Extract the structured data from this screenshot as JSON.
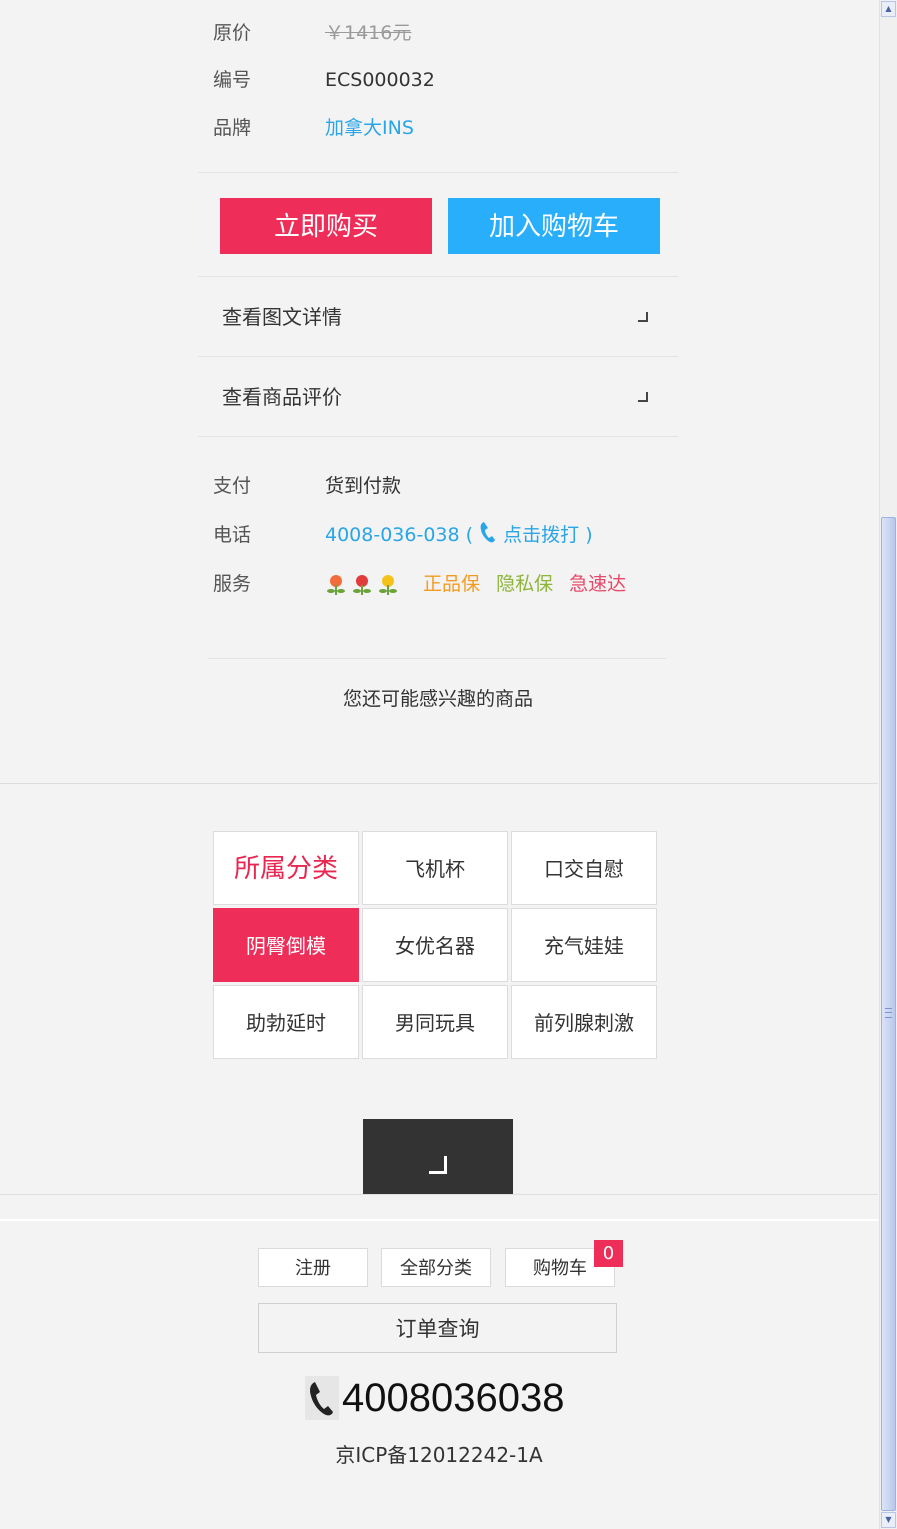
{
  "product_info": {
    "original_price_label": "原价",
    "original_price_value": "￥1416元",
    "sku_label": "编号",
    "sku_value": "ECS000032",
    "brand_label": "品牌",
    "brand_value": "加拿大INS"
  },
  "actions": {
    "buy_now": "立即购买",
    "add_to_cart": "加入购物车"
  },
  "detail_links": {
    "view_details": "查看图文详情",
    "view_reviews": "查看商品评价"
  },
  "service_info": {
    "payment_label": "支付",
    "payment_value": "货到付款",
    "phone_label": "电话",
    "phone_number": "4008-036-038",
    "phone_open_paren": "(",
    "phone_call_text": "点击拨打",
    "phone_close_paren": ")",
    "service_label": "服务",
    "service_tags": [
      "正品保",
      "隐私保",
      "急速达"
    ]
  },
  "recommend_title": "您还可能感兴趣的商品",
  "categories": {
    "title": "所属分类",
    "items": [
      "飞机杯",
      "口交自慰",
      "阴臀倒模",
      "女优名器",
      "充气娃娃",
      "助勃延时",
      "男同玩具",
      "前列腺刺激"
    ]
  },
  "footer": {
    "register": "注册",
    "all_categories": "全部分类",
    "cart": "购物车",
    "cart_count": "0",
    "order_query": "订单查询",
    "hotline": "4008036038",
    "icp": "京ICP备12012242-1A"
  },
  "colors": {
    "accent_red": "#ee2d59",
    "accent_blue": "#29aefb",
    "link_blue": "#29a5e8"
  },
  "icons": [
    "phone-icon",
    "flower-icon",
    "chevron-corner-icon",
    "back-to-top-icon",
    "scroll-up-icon",
    "scroll-down-icon"
  ]
}
